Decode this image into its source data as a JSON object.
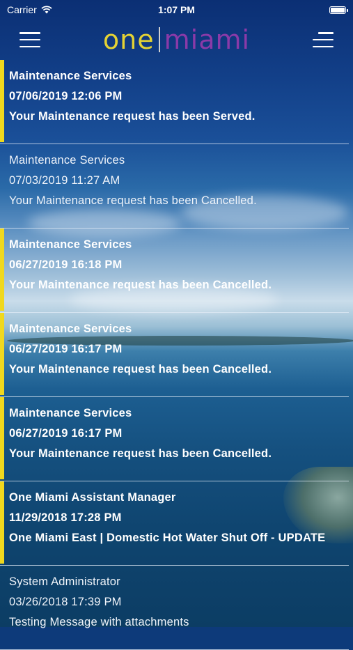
{
  "status_bar": {
    "carrier": "Carrier",
    "time": "1:07 PM"
  },
  "header": {
    "logo_left": "one",
    "logo_right": "miami",
    "logo_left_color": "#e4d234",
    "logo_right_color": "#8a3aa8"
  },
  "notifications": [
    {
      "sender": "Maintenance Services",
      "date": "07/06/2019 12:06 PM",
      "message": "Your  Maintenance request has been Served.",
      "unread": true
    },
    {
      "sender": "Maintenance Services",
      "date": "07/03/2019 11:27 AM",
      "message": "Your  Maintenance request has been Cancelled.",
      "unread": false
    },
    {
      "sender": "Maintenance Services",
      "date": "06/27/2019 16:18 PM",
      "message": "Your  Maintenance request has been Cancelled.",
      "unread": true
    },
    {
      "sender": "Maintenance Services",
      "date": "06/27/2019 16:17 PM",
      "message": "Your  Maintenance request has been Cancelled.",
      "unread": true
    },
    {
      "sender": "Maintenance Services",
      "date": "06/27/2019 16:17 PM",
      "message": "Your  Maintenance request has been Cancelled.",
      "unread": true
    },
    {
      "sender": "One Miami Assistant Manager",
      "date": "11/29/2018 17:28 PM",
      "message": "One Miami East |  Domestic Hot Water Shut Off - UPDATE",
      "unread": true
    },
    {
      "sender": "System Administrator",
      "date": "03/26/2018 17:39 PM",
      "message": "Testing Message with attachments",
      "unread": false
    }
  ],
  "colors": {
    "unread_indicator": "#f0d81e",
    "divider": "#e1ebf5"
  }
}
